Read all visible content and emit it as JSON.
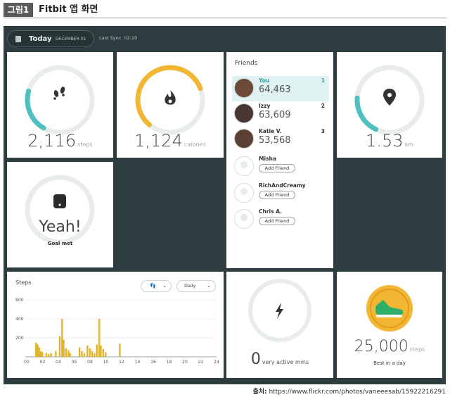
{
  "figure": {
    "tag": "그림1",
    "title": "Fitbit 앱 화면"
  },
  "topbar": {
    "today": "Today",
    "date": "DECEMBER 01",
    "last_sync": "Last Sync: 02:20"
  },
  "steps_tile": {
    "value": "2,116",
    "unit": "steps",
    "progress": 0.21
  },
  "calories_tile": {
    "value": "1,124",
    "unit": "calories",
    "progress": 0.58
  },
  "distance_tile": {
    "value": "1.53",
    "unit": "km",
    "progress": 0.19
  },
  "goal_tile": {
    "headline": "Yeah!",
    "caption": "Goal met"
  },
  "friends": {
    "title": "Friends",
    "add_label": "Add Friend",
    "entries": [
      {
        "name": "You",
        "score": "64,463",
        "rank": "1"
      },
      {
        "name": "Izzy",
        "score": "63,609",
        "rank": "2"
      },
      {
        "name": "Katie V.",
        "score": "53,568",
        "rank": "3"
      },
      {
        "name": "Misha"
      },
      {
        "name": "RichAndCreamy"
      },
      {
        "name": "Chris A."
      }
    ]
  },
  "steps_chart": {
    "title": "Steps",
    "filter_label": "Daily"
  },
  "active_tile": {
    "value": "0",
    "unit": "very active mins"
  },
  "best_tile": {
    "value": "25,000",
    "unit": "steps",
    "caption": "Best in a day"
  },
  "source": {
    "label": "출처:",
    "url": "https://www.flickr.com/photos/vaneeesab/15922216291"
  },
  "colors": {
    "teal": "#4fbfbf",
    "yellow": "#f2b632",
    "bar": "#e2b42b",
    "background": "#2d3c3e"
  },
  "chart_data": {
    "type": "bar",
    "x_ticks": [
      "00",
      "02",
      "04",
      "06",
      "08",
      "10",
      "12",
      "14",
      "16",
      "18",
      "20",
      "22",
      "24"
    ],
    "y_ticks": [
      "600",
      "400",
      "200"
    ],
    "ylim": [
      0,
      600
    ],
    "x_hours": [
      0.0,
      0.2,
      0.4,
      0.6,
      0.8,
      1.3,
      1.6,
      1.9,
      2.5,
      3.0,
      3.3,
      3.5,
      3.8,
      4.1,
      4.3,
      5.5,
      5.8,
      6.1,
      6.5,
      6.8,
      7.1,
      7.4,
      7.7,
      8.0,
      8.2,
      8.5,
      8.8,
      10.6
    ],
    "values": [
      150,
      130,
      100,
      60,
      50,
      40,
      30,
      40,
      60,
      220,
      400,
      180,
      90,
      70,
      40,
      100,
      60,
      40,
      120,
      90,
      60,
      40,
      130,
      400,
      120,
      80,
      50,
      140
    ]
  }
}
